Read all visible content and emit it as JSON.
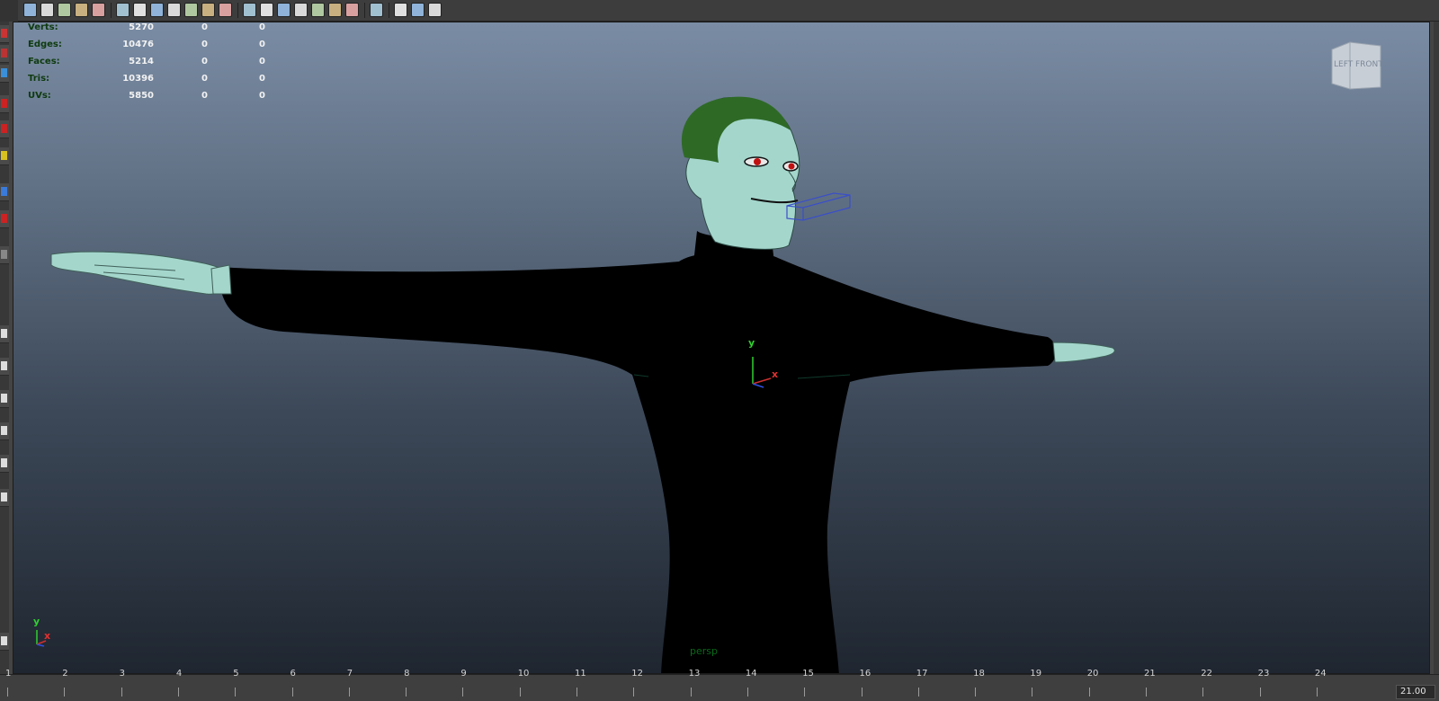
{
  "toolbar": {
    "groups": [
      [
        "camera-attr-icon",
        "bookmark-icon",
        "image-plane-icon",
        "grid-icon",
        "film-gate-icon"
      ],
      [
        "wireframe-icon",
        "smooth-shade-icon",
        "shade-all-icon",
        "bounding-box-icon",
        "textured-icon",
        "use-default-material-icon",
        "texture-icon"
      ],
      [
        "lights-icon",
        "shadows-icon",
        "ambient-occlusion-icon",
        "anti-alias-icon",
        "light-bulb-icon",
        "sphere-icon",
        "gold-sphere-icon"
      ],
      [
        "select-camera-icon"
      ],
      [
        "isolate-icon",
        "xray-icon",
        "graph-icon"
      ]
    ]
  },
  "hud": {
    "rows": [
      {
        "label": "Verts:",
        "v1": "5270",
        "v2": "0",
        "v3": "0"
      },
      {
        "label": "Edges:",
        "v1": "10476",
        "v2": "0",
        "v3": "0"
      },
      {
        "label": "Faces:",
        "v1": "5214",
        "v2": "0",
        "v3": "0"
      },
      {
        "label": "Tris:",
        "v1": "10396",
        "v2": "0",
        "v3": "0"
      },
      {
        "label": "UVs:",
        "v1": "5850",
        "v2": "0",
        "v3": "0"
      }
    ]
  },
  "viewcube": {
    "left_label": "LEFT",
    "front_label": "FRONT"
  },
  "camera_name": "persp",
  "axis": {
    "y": "y",
    "x": "x"
  },
  "timeline": {
    "ticks": [
      "1",
      "2",
      "3",
      "4",
      "5",
      "6",
      "7",
      "8",
      "9",
      "10",
      "11",
      "12",
      "13",
      "14",
      "15",
      "16",
      "17",
      "18",
      "19",
      "20",
      "21",
      "22",
      "23",
      "24"
    ],
    "current_frame": "21.00"
  },
  "colors": {
    "viewport_top": "#7a8ca4",
    "viewport_bottom": "#1f2630",
    "skin": "#a4d6cc",
    "hair": "#2e6a26",
    "suit": "#000000",
    "hud_label": "#0e3a0e",
    "hud_value": "#f2f2f2",
    "camera_label": "#0a6a1a"
  }
}
